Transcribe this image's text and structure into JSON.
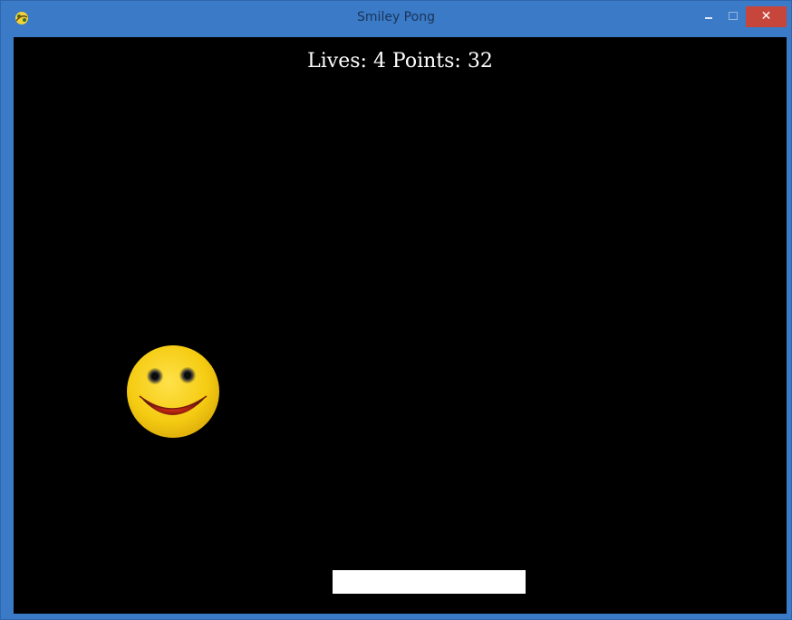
{
  "window": {
    "title": "Smiley Pong",
    "icon": "pygame-snake-icon",
    "controls": {
      "minimize_icon": "minimize-icon",
      "maximize_icon": "maximize-icon",
      "close_label": "✕"
    }
  },
  "hud": {
    "text": "Lives: 4 Points: 32"
  },
  "game": {
    "ball_icon": "smiley-face-icon",
    "background_color": "#000000",
    "paddle_color": "#ffffff",
    "ball_color": "#f5cc12"
  }
}
